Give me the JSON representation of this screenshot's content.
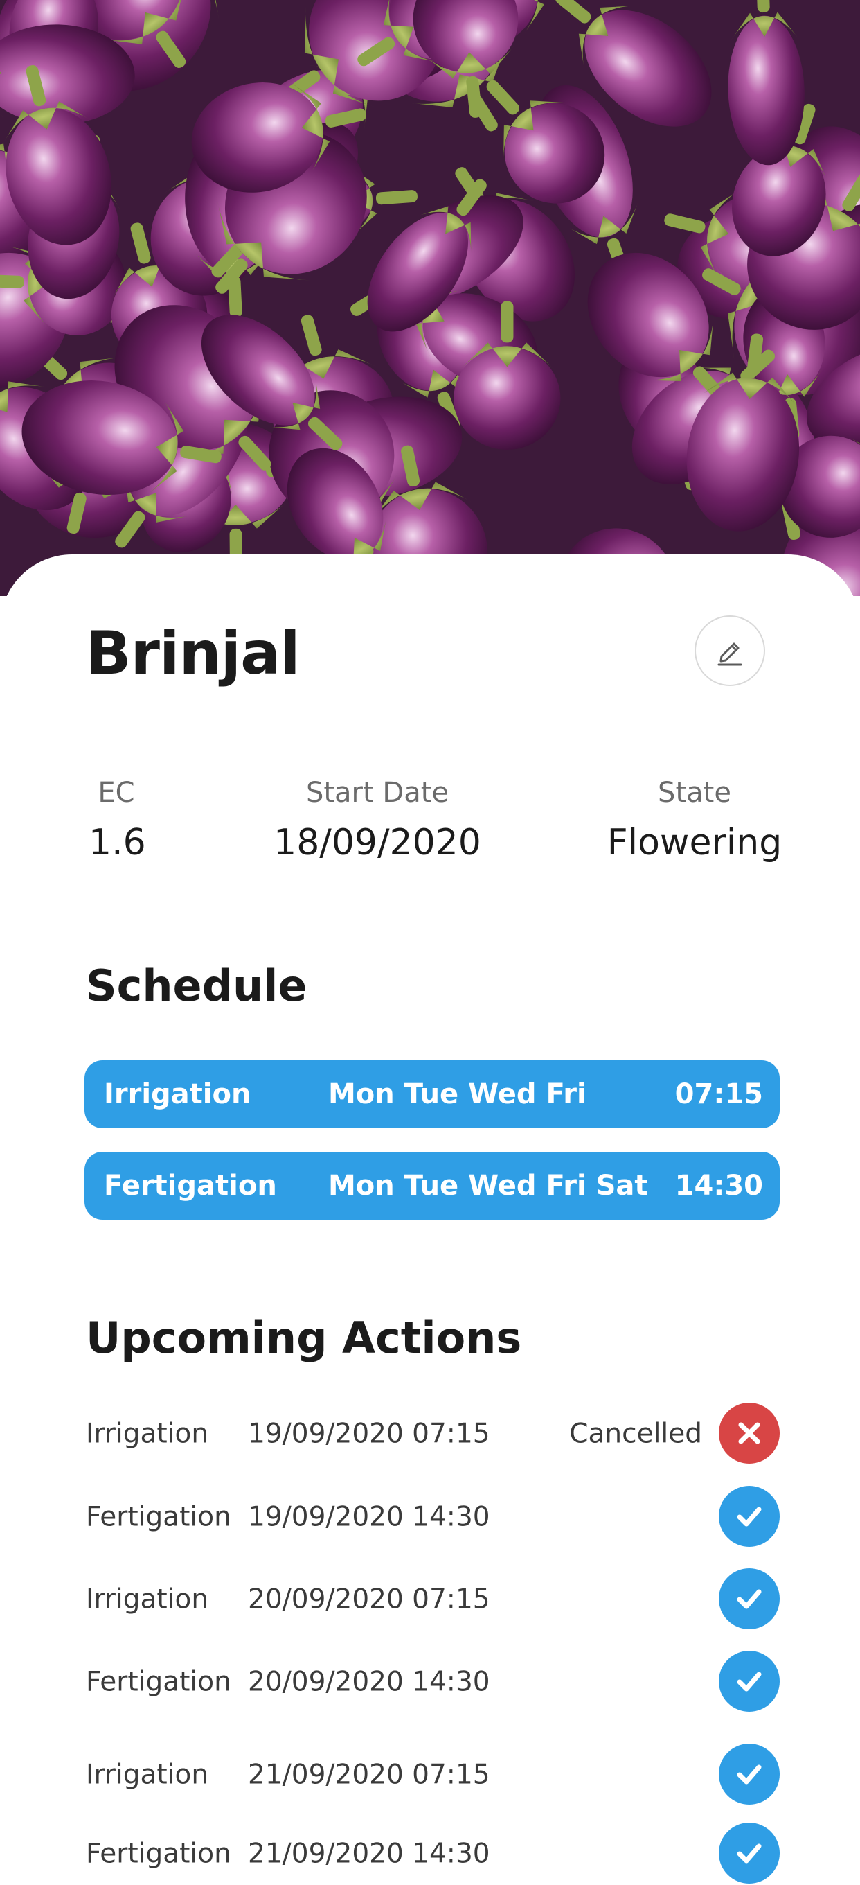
{
  "crop": {
    "name": "Brinjal",
    "ec_label": "EC",
    "ec_value": "1.6",
    "start_date_label": "Start Date",
    "start_date_value": "18/09/2020",
    "state_label": "State",
    "state_value": "Flowering"
  },
  "schedule": {
    "title": "Schedule",
    "items": [
      {
        "type": "Irrigation",
        "days": "Mon Tue Wed Fri",
        "time": "07:15"
      },
      {
        "type": "Fertigation",
        "days": "Mon Tue Wed Fri Sat",
        "time": "14:30"
      }
    ]
  },
  "upcoming": {
    "title": "Upcoming Actions",
    "items": [
      {
        "type": "Irrigation",
        "datetime": "19/09/2020 07:15",
        "status": "Cancelled",
        "icon": "close-icon"
      },
      {
        "type": "Fertigation",
        "datetime": "19/09/2020 14:30",
        "status": "",
        "icon": "check-icon"
      },
      {
        "type": "Irrigation",
        "datetime": "20/09/2020 07:15",
        "status": "",
        "icon": "check-icon"
      },
      {
        "type": "Fertigation",
        "datetime": "20/09/2020 14:30",
        "status": "",
        "icon": "check-icon"
      },
      {
        "type": "Irrigation",
        "datetime": "21/09/2020 07:15",
        "status": "",
        "icon": "check-icon"
      },
      {
        "type": "Fertigation",
        "datetime": "21/09/2020 14:30",
        "status": "",
        "icon": "check-icon"
      }
    ]
  },
  "icons": {
    "edit": "pencil-icon",
    "done": "check-icon",
    "cancelled": "close-icon"
  },
  "colors": {
    "accent": "#2f9ee5",
    "danger": "#d84545"
  }
}
